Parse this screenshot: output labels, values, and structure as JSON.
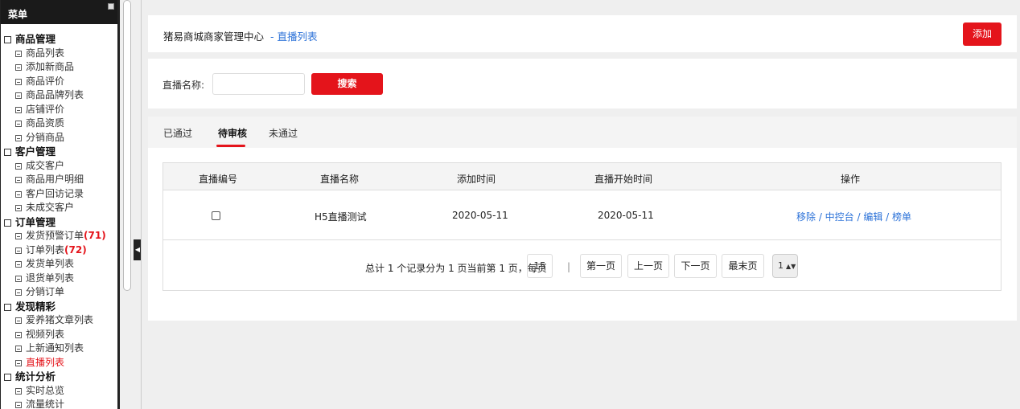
{
  "sidebar": {
    "title": "菜单",
    "groups": [
      {
        "label": "商品管理",
        "items": [
          "商品列表",
          "添加新商品",
          "商品评价",
          "商品品牌列表",
          "店铺评价",
          "商品资质",
          "分销商品"
        ]
      },
      {
        "label": "客户管理",
        "items": [
          "成交客户",
          "商品用户明细",
          "客户回访记录",
          "未成交客户"
        ]
      },
      {
        "label": "订单管理",
        "items": [
          "发货预警订单",
          "订单列表",
          "发货单列表",
          "退货单列表",
          "分销订单"
        ],
        "counts": {
          "0": "(71)",
          "1": "(72)"
        }
      },
      {
        "label": "发现精彩",
        "items": [
          "爱养猪文章列表",
          "视频列表",
          "上新通知列表",
          "直播列表"
        ],
        "active": "直播列表"
      },
      {
        "label": "统计分析",
        "items": [
          "实时总览",
          "流量统计"
        ]
      }
    ]
  },
  "header": {
    "site_title": "猪易商城商家管理中心",
    "breadcrumb": "- 直播列表",
    "add_label": "添加"
  },
  "search": {
    "label": "直播名称:",
    "button_label": "搜索",
    "value": ""
  },
  "tabs": [
    {
      "label": "已通过"
    },
    {
      "label": "待审核",
      "active": true
    },
    {
      "label": "未通过"
    }
  ],
  "table": {
    "columns": [
      "直播编号",
      "直播名称",
      "添加时间",
      "直播开始时间",
      "操作"
    ],
    "rows": [
      {
        "name": "H5直播测试",
        "added": "2020-05-11",
        "start": "2020-05-11",
        "ops": "移除 / 中控台 / 编辑 / 榜单"
      }
    ]
  },
  "pager": {
    "summary": "总计 1 个记录分为 1 页当前第 1 页，每页",
    "page_size": "15",
    "separator": "|",
    "first": "第一页",
    "prev": "上一页",
    "next": "下一页",
    "last": "最末页",
    "page_select": "1"
  },
  "colors": {
    "accent": "#e4141b",
    "link": "#2c72d8"
  }
}
